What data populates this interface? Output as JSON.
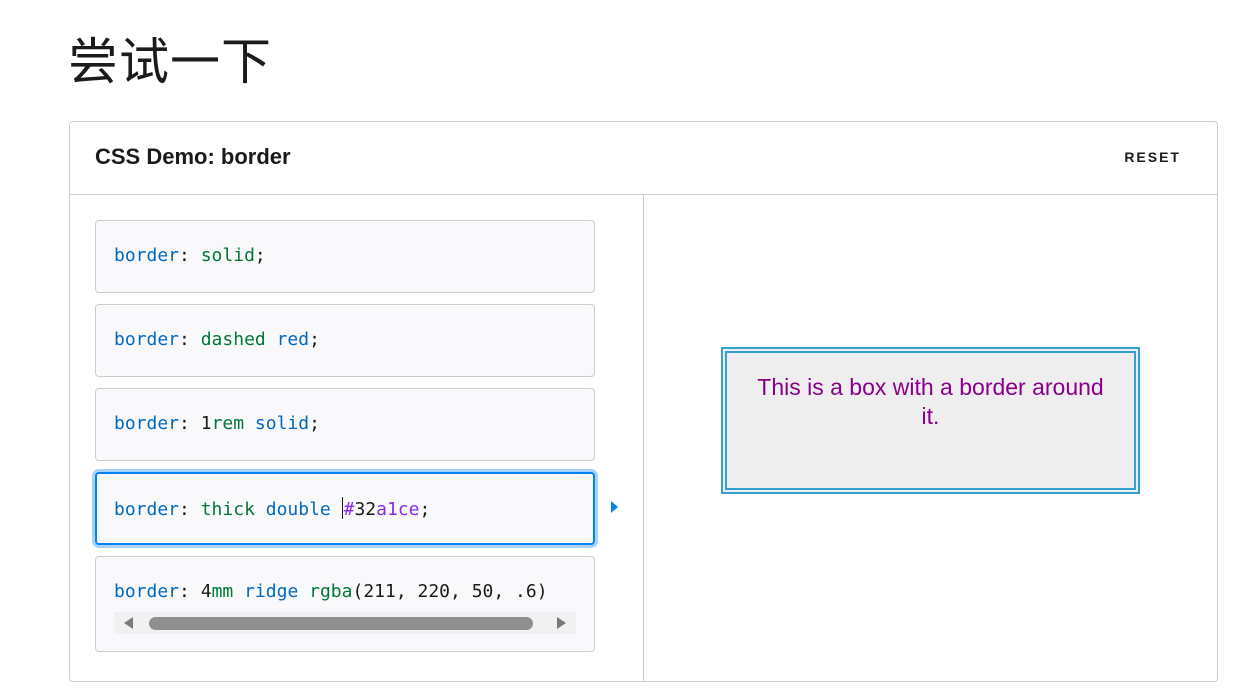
{
  "page": {
    "title": "尝试一下"
  },
  "demo": {
    "title": "CSS Demo: border",
    "reset_label": "RESET"
  },
  "choices": [
    {
      "prop": "border",
      "colon": ": ",
      "tokens": [
        {
          "t": "solid",
          "k": "val"
        }
      ],
      "end": ";"
    },
    {
      "prop": "border",
      "colon": ": ",
      "tokens": [
        {
          "t": "dashed",
          "k": "val"
        },
        {
          "t": " ",
          "k": "sp"
        },
        {
          "t": "red",
          "k": "kw"
        }
      ],
      "end": ";"
    },
    {
      "prop": "border",
      "colon": ": ",
      "tokens": [
        {
          "t": "1",
          "k": "num"
        },
        {
          "t": "rem",
          "k": "val"
        },
        {
          "t": " ",
          "k": "sp"
        },
        {
          "t": "solid",
          "k": "kw"
        }
      ],
      "end": ";"
    },
    {
      "prop": "border",
      "colon": ": ",
      "tokens": [
        {
          "t": "thick",
          "k": "val"
        },
        {
          "t": " ",
          "k": "sp"
        },
        {
          "t": "double",
          "k": "kw"
        },
        {
          "t": " ",
          "k": "sp"
        },
        {
          "t": "#",
          "k": "hex"
        },
        {
          "t": "32",
          "k": "num"
        },
        {
          "t": "a1ce",
          "k": "hex"
        }
      ],
      "end": ";",
      "active": true
    },
    {
      "prop": "border",
      "colon": ": ",
      "tokens": [
        {
          "t": "4",
          "k": "num"
        },
        {
          "t": "mm",
          "k": "val"
        },
        {
          "t": " ",
          "k": "sp"
        },
        {
          "t": "ridge",
          "k": "kw"
        },
        {
          "t": " ",
          "k": "sp"
        },
        {
          "t": "rgba",
          "k": "val"
        },
        {
          "t": "(211, 220, 50, .6)",
          "k": "num"
        }
      ],
      "end": ""
    }
  ],
  "output": {
    "text": "This is a box with a border around it."
  },
  "colors": {
    "accent": "#0085f2",
    "box_border": "#32a1ce",
    "box_text": "#8b008b"
  }
}
